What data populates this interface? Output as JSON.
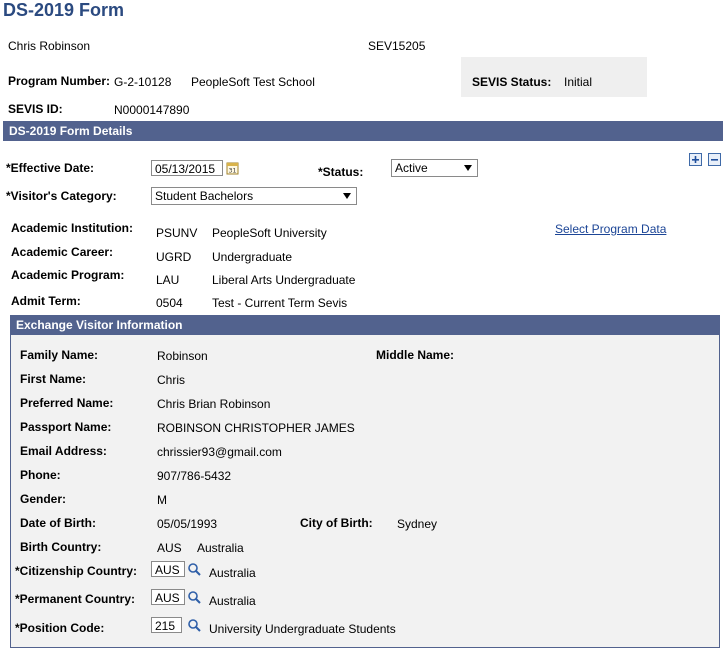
{
  "page": {
    "title": "DS-2019 Form",
    "student_name": "Chris Robinson",
    "sevis_code": "SEV15205",
    "program_number_label": "Program Number:",
    "program_number_value": "G-2-10128",
    "school_name": "PeopleSoft Test School",
    "sevis_status_label": "SEVIS Status:",
    "sevis_status_value": "Initial",
    "sevis_id_label": "SEVIS ID:",
    "sevis_id_value": "N0000147890"
  },
  "details": {
    "section_title": "DS-2019 Form Details",
    "effective_date_label": "Effective Date:",
    "effective_date_value": "05/13/2015",
    "status_label": "Status:",
    "status_value": "Active",
    "visitor_category_label": "Visitor's Category:",
    "visitor_category_value": "Student Bachelors",
    "select_program_link": "Select Program Data",
    "academic_rows": [
      {
        "label": "Academic Institution:",
        "code": "PSUNV",
        "desc": "PeopleSoft University"
      },
      {
        "label": "Academic Career:",
        "code": "UGRD",
        "desc": "Undergraduate"
      },
      {
        "label": "Academic Program:",
        "code": "LAU",
        "desc": "Liberal Arts Undergraduate"
      },
      {
        "label": "Admit Term:",
        "code": "0504",
        "desc": "Test - Current Term Sevis"
      }
    ]
  },
  "visitor": {
    "section_title": "Exchange Visitor Information",
    "family_name_label": "Family Name:",
    "family_name_value": "Robinson",
    "middle_name_label": "Middle Name:",
    "middle_name_value": "",
    "first_name_label": "First Name:",
    "first_name_value": "Chris",
    "preferred_name_label": "Preferred Name:",
    "preferred_name_value": "Chris Brian Robinson",
    "passport_name_label": "Passport Name:",
    "passport_name_value": "ROBINSON CHRISTOPHER JAMES",
    "email_label": "Email Address:",
    "email_value": "chrissier93@gmail.com",
    "phone_label": "Phone:",
    "phone_value": "907/786-5432",
    "gender_label": "Gender:",
    "gender_value": "M",
    "dob_label": "Date of Birth:",
    "dob_value": "05/05/1993",
    "city_birth_label": "City of Birth:",
    "city_birth_value": "Sydney",
    "birth_country_label": "Birth Country:",
    "birth_country_code": "AUS",
    "birth_country_desc": "Australia",
    "citizenship_label": "Citizenship Country:",
    "citizenship_code": "AUS",
    "citizenship_desc": "Australia",
    "permanent_label": "Permanent Country:",
    "permanent_code": "AUS",
    "permanent_desc": "Australia",
    "position_label": "Position Code:",
    "position_code": "215",
    "position_desc": "University Undergraduate Students"
  },
  "icons": {
    "calendar": "calendar-icon",
    "lookup": "magnifier-icon",
    "add_row": "plus-icon",
    "delete_row": "minus-icon"
  },
  "colors": {
    "title": "#2b4a80",
    "section_bar": "#52628e",
    "link": "#1c4596",
    "panel_bg": "#f2f2f2"
  }
}
